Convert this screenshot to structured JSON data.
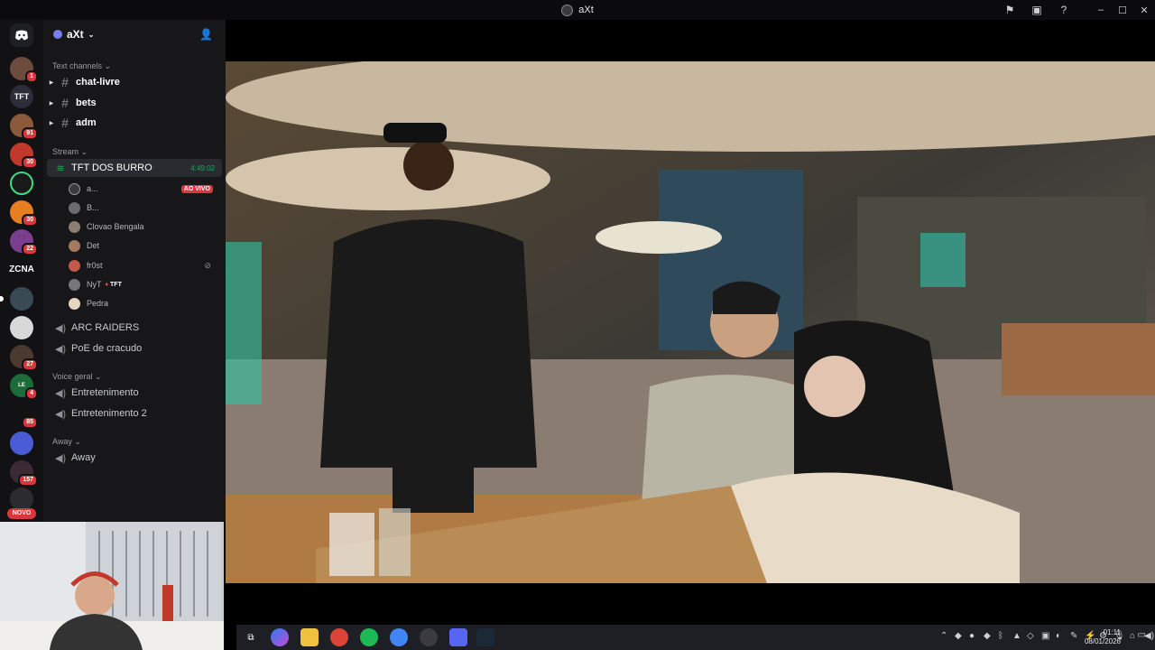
{
  "window": {
    "title": "aXt"
  },
  "rail": {
    "servers": [
      {
        "badge": "1"
      },
      {
        "badge": ""
      },
      {
        "badge": "91"
      },
      {
        "badge": "30"
      },
      {
        "badge": ""
      },
      {
        "badge": "30"
      },
      {
        "badge": "22"
      },
      {
        "badge": ""
      },
      {
        "badge": ""
      },
      {
        "badge": "27"
      },
      {
        "badge": "4"
      },
      {
        "badge": "85"
      },
      {
        "badge": ""
      },
      {
        "badge": "157"
      }
    ],
    "folder_label": "ZCNA",
    "new_label": "NOVO"
  },
  "sidebar": {
    "guild_name": "aXt",
    "categories": {
      "text": "Text channels",
      "stream": "Stream",
      "voice": "Voice geral",
      "away": "Away"
    },
    "text_channels": [
      "chat-livre",
      "bets",
      "adm"
    ],
    "stream_channel": {
      "name": "TFT DOS BURRO",
      "timer": "4:49:02"
    },
    "members": [
      {
        "name": "a...",
        "live": "AO VIVO"
      },
      {
        "name": "B..."
      },
      {
        "name": "Clovao Bengala"
      },
      {
        "name": "Det"
      },
      {
        "name": "fr0st"
      },
      {
        "name": "NyT",
        "tag": "TFT"
      },
      {
        "name": "Pedra"
      }
    ],
    "other_stream_channels": [
      "ARC RAIDERS",
      "PoE de cracudo"
    ],
    "voice_channels": [
      "Entretenimento",
      "Entretenimento 2"
    ],
    "away_channels": [
      "Away"
    ]
  },
  "taskbar": {
    "time": "01:11",
    "date": "08/01/2026"
  },
  "colors": {
    "accent": "#5865f2",
    "live": "#da373c",
    "online": "#23a55a"
  }
}
